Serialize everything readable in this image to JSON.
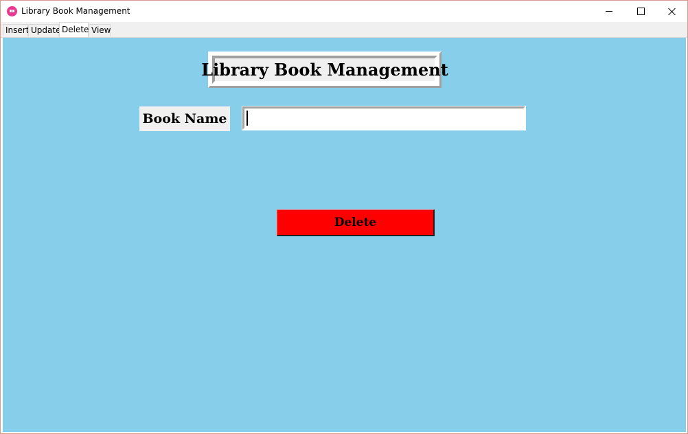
{
  "window": {
    "title": "Library Book Management",
    "icon": "app-icon",
    "controls": [
      "minimize-icon",
      "maximize-icon",
      "close-icon"
    ]
  },
  "tabs": [
    {
      "label": "Insert",
      "active": false
    },
    {
      "label": "Update",
      "active": false
    },
    {
      "label": "Delete",
      "active": true
    },
    {
      "label": "View",
      "active": false
    }
  ],
  "main": {
    "heading": "Library Book Management",
    "book_name_label": "Book Name",
    "book_name_value": "",
    "delete_label": "Delete"
  },
  "colors": {
    "background": "#87ceeb",
    "delete_button": "#ff0000",
    "app_icon": "#e8388f"
  }
}
